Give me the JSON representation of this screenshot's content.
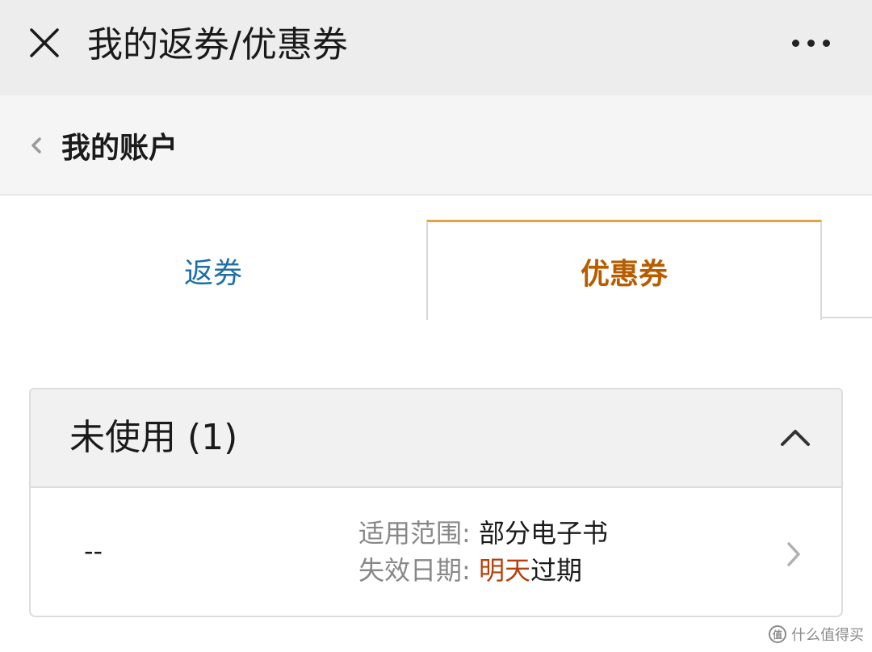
{
  "topbar": {
    "title": "我的返券/优惠券",
    "close_icon": "close-icon",
    "more_icon": "more-dots-icon"
  },
  "subheader": {
    "back_label": "我的账户",
    "back_icon": "chevron-left-icon"
  },
  "tabs": [
    {
      "label": "返券",
      "active": false
    },
    {
      "label": "优惠券",
      "active": true
    }
  ],
  "section": {
    "title": "未使用 (1)",
    "expanded": true,
    "toggle_icon": "chevron-up-icon"
  },
  "coupons": [
    {
      "amount": "--",
      "scope_label": "适用范围: ",
      "scope_value": "部分电子书",
      "expiry_label": "失效日期: ",
      "expiry_highlight": "明天",
      "expiry_rest": "过期"
    }
  ],
  "watermark": {
    "logo": "值",
    "text": "什么值得买"
  },
  "colors": {
    "topbar_bg": "#ededed",
    "tab_inactive_text": "#1f6fa6",
    "tab_active_text": "#b85c00",
    "tab_active_border": "#e2a245",
    "expiry_highlight": "#b8400a"
  }
}
